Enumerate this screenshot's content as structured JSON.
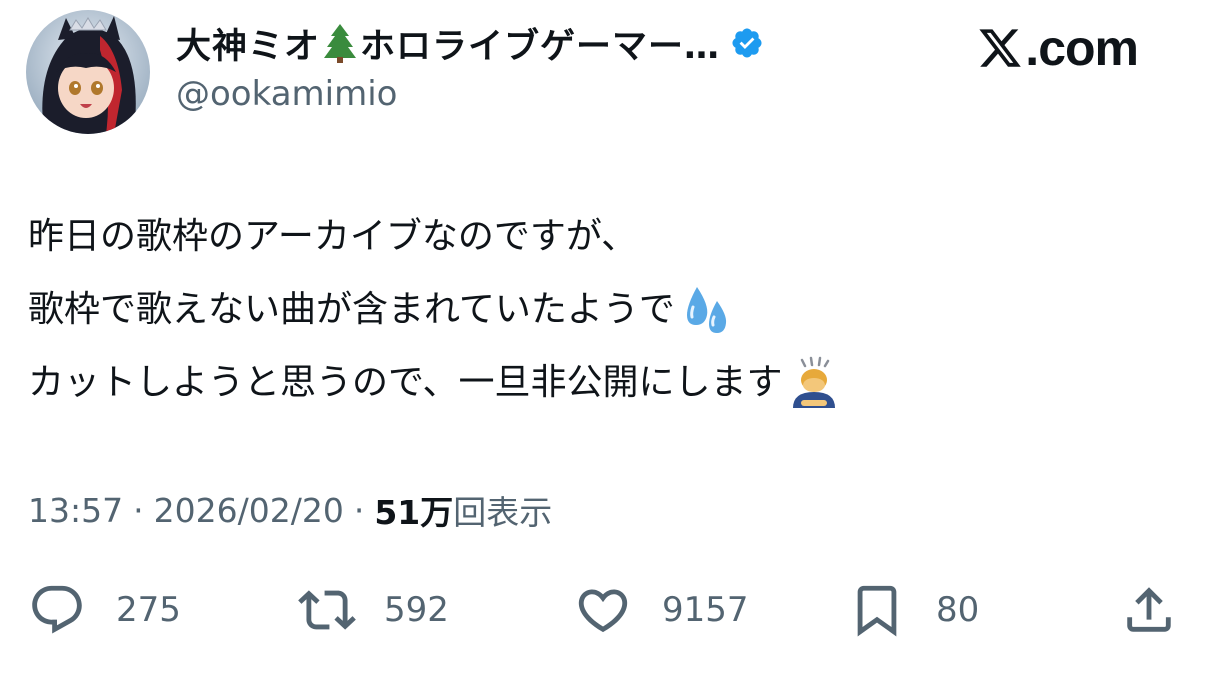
{
  "brand": {
    "logo_text": ".com",
    "logo_icon": "x-logo-icon"
  },
  "author": {
    "display_name_part1": "大神ミオ",
    "name_emoji": "evergreen-tree-icon",
    "display_name_part2": "ホロライブゲーマー…",
    "handle": "@ookamimio",
    "verified_color": "#1d9bf0"
  },
  "tweet": {
    "lines": [
      "昨日の歌枠のアーカイブなのですが、",
      "歌枠で歌えない曲が含まれていたようで",
      "カットしようと思うので、一旦非公開にします"
    ],
    "line_emojis": [
      "",
      "sweat-droplets-icon",
      "bowing-person-icon"
    ]
  },
  "meta": {
    "time": "13:57",
    "separator": "·",
    "date": "2026/02/20",
    "views_count": "51万",
    "views_label": "回表示"
  },
  "actions": {
    "replies": "275",
    "reposts": "592",
    "likes": "9157",
    "bookmarks": "80"
  },
  "colors": {
    "text_primary": "#0f1419",
    "text_secondary": "#536471",
    "verified": "#1d9bf0"
  }
}
